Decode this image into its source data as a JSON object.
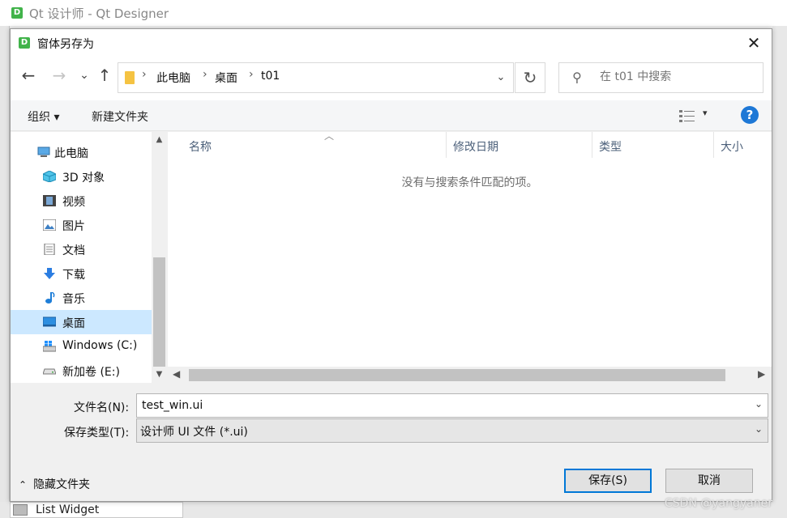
{
  "background_window": {
    "title": "Qt 设计师 - Qt Designer",
    "icon_letter": "D",
    "list_widget_label": "List Widget"
  },
  "dialog": {
    "title": "窗体另存为",
    "icon_letter": "D",
    "close_glyph": "✕"
  },
  "address_bar": {
    "back": "←",
    "forward": "→",
    "recent": "⌄",
    "up": "↑",
    "breadcrumbs": [
      "此电脑",
      "桌面",
      "t01"
    ],
    "separator": "›",
    "dropdown": "⌄",
    "refresh": "↻"
  },
  "search": {
    "placeholder": "在 t01 中搜索"
  },
  "toolbar": {
    "organize": "组织 ▾",
    "new_folder": "新建文件夹",
    "view_dropdown": "▾",
    "help": "?"
  },
  "nav_pane": {
    "items": [
      {
        "label": "此电脑",
        "icon": "computer-icon"
      },
      {
        "label": "3D 对象",
        "icon": "cube-icon"
      },
      {
        "label": "视频",
        "icon": "film-icon"
      },
      {
        "label": "图片",
        "icon": "picture-icon"
      },
      {
        "label": "文档",
        "icon": "document-icon"
      },
      {
        "label": "下载",
        "icon": "download-icon"
      },
      {
        "label": "音乐",
        "icon": "music-icon"
      },
      {
        "label": "桌面",
        "icon": "desktop-icon",
        "selected": true
      },
      {
        "label": "Windows (C:)",
        "icon": "drive-c-icon"
      },
      {
        "label": "新加卷 (E:)",
        "icon": "drive-e-icon"
      }
    ]
  },
  "file_list": {
    "columns": [
      "名称",
      "修改日期",
      "类型",
      "大小"
    ],
    "empty_message": "没有与搜索条件匹配的项。"
  },
  "form": {
    "filename_label": "文件名(N):",
    "filename_value": "test_win.ui",
    "filetype_label": "保存类型(T):",
    "filetype_value": "设计师 UI 文件 (*.ui)"
  },
  "footer": {
    "hide_folders": "隐藏文件夹",
    "save": "保存(S)",
    "cancel": "取消"
  },
  "watermark": "CSDN @yangyaner"
}
